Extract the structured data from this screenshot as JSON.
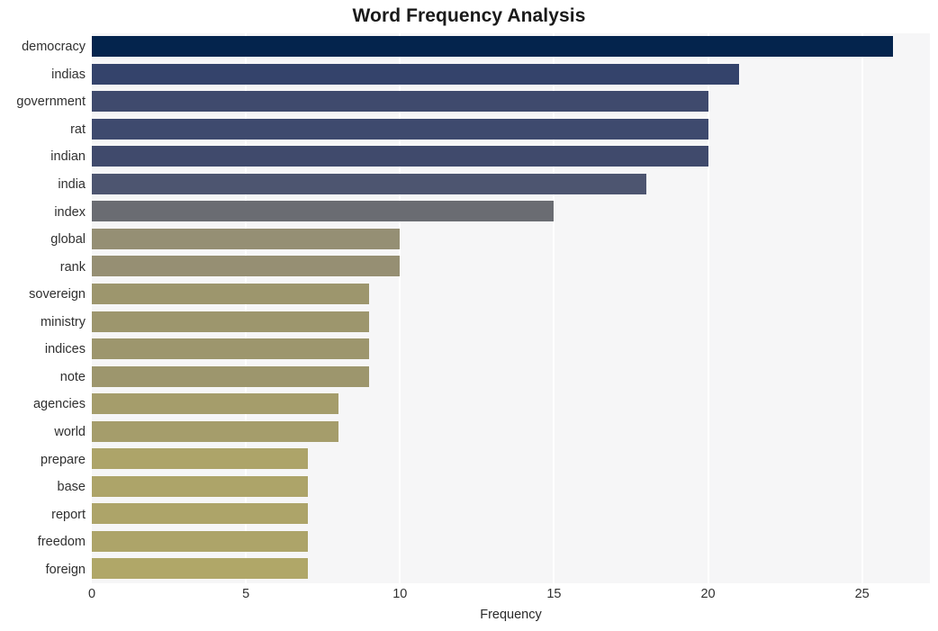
{
  "chart_data": {
    "type": "bar",
    "orientation": "horizontal",
    "title": "Word Frequency Analysis",
    "xlabel": "Frequency",
    "ylabel": "",
    "xlim": [
      0,
      27.2
    ],
    "ylim": [
      0,
      20
    ],
    "grid": true,
    "legend": null,
    "xticks": [
      0,
      5,
      10,
      15,
      20,
      25
    ],
    "xtick_labels": [
      "0",
      "5",
      "10",
      "15",
      "20",
      "25"
    ],
    "categories": [
      "democracy",
      "indias",
      "government",
      "rat",
      "indian",
      "india",
      "index",
      "global",
      "rank",
      "sovereign",
      "ministry",
      "indices",
      "note",
      "agencies",
      "world",
      "prepare",
      "base",
      "report",
      "freedom",
      "foreign"
    ],
    "values": [
      26,
      21,
      20,
      20,
      20,
      18,
      15,
      10,
      10,
      9,
      9,
      9,
      9,
      8,
      8,
      7,
      7,
      7,
      7,
      7
    ],
    "bar_colors": [
      "#04244d",
      "#34436b",
      "#3f4a6d",
      "#3e4a6e",
      "#404a6c",
      "#4d5570",
      "#6a6c72",
      "#958f74",
      "#968f73",
      "#9d966d",
      "#9d966d",
      "#9d966d",
      "#9d966d",
      "#a59d6b",
      "#a59d6b",
      "#ada469",
      "#ada469",
      "#ada469",
      "#ada469",
      "#b0a768"
    ]
  },
  "style": {
    "figure_background": "#ffffff",
    "plot_background": "#f6f6f7",
    "gridline_color": "#ffffff",
    "title_color": "#1a1a1a",
    "tick_color": "#303030"
  }
}
